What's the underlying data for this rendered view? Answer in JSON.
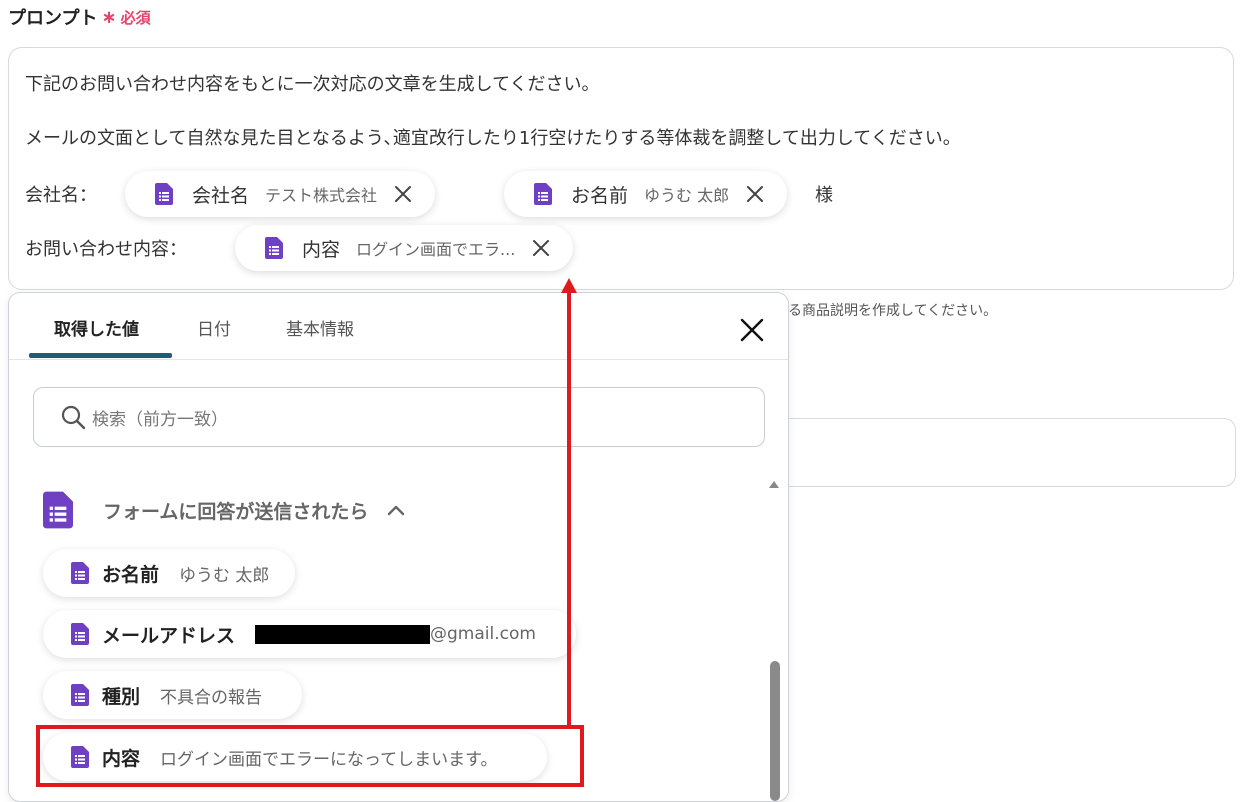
{
  "field": {
    "label": "プロンプト",
    "required_mark": "∗",
    "required_text": "必須"
  },
  "prompt": {
    "line1": "下記のお問い合わせ内容をもとに一次対応の文章を生成してください。",
    "line2": "メールの文面として自然な見た目となるよう､適宜改行したり1行空けたりする等体裁を調整して出力してください。",
    "company_label": "会社名：",
    "suffix": "様",
    "inquiry_label": "お問い合わせ内容：",
    "tags": [
      {
        "name": "会社名",
        "value": "テスト株式会社"
      },
      {
        "name": "お名前",
        "value": "ゆうむ 太郎"
      },
      {
        "name": "内容",
        "value": "ログイン画面でエラ..."
      }
    ]
  },
  "hint_text": "作成する商品説明を作成してください。",
  "panel": {
    "tabs": [
      "取得した値",
      "日付",
      "基本情報"
    ],
    "active_tab": "取得した値",
    "search_placeholder": "検索（前方一致）",
    "group_title": "フォームに回答が送信されたら",
    "items": [
      {
        "name": "お名前",
        "value": "ゆうむ 太郎"
      },
      {
        "name": "メールアドレス",
        "value": "@gmail.com"
      },
      {
        "name": "種別",
        "value": "不具合の報告"
      },
      {
        "name": "内容",
        "value": "ログイン画面でエラーになってしまいます。"
      }
    ]
  },
  "colors": {
    "required": "#e8436a",
    "icon_purple": "#6f3fc4",
    "tab_underline": "#1d5e74",
    "annotation_red": "#e0191f"
  },
  "icons": {
    "tag_icon": "form-document-icon",
    "remove_icon": "close-icon",
    "search_icon": "search-icon",
    "collapse_icon": "chevron-up-icon"
  }
}
